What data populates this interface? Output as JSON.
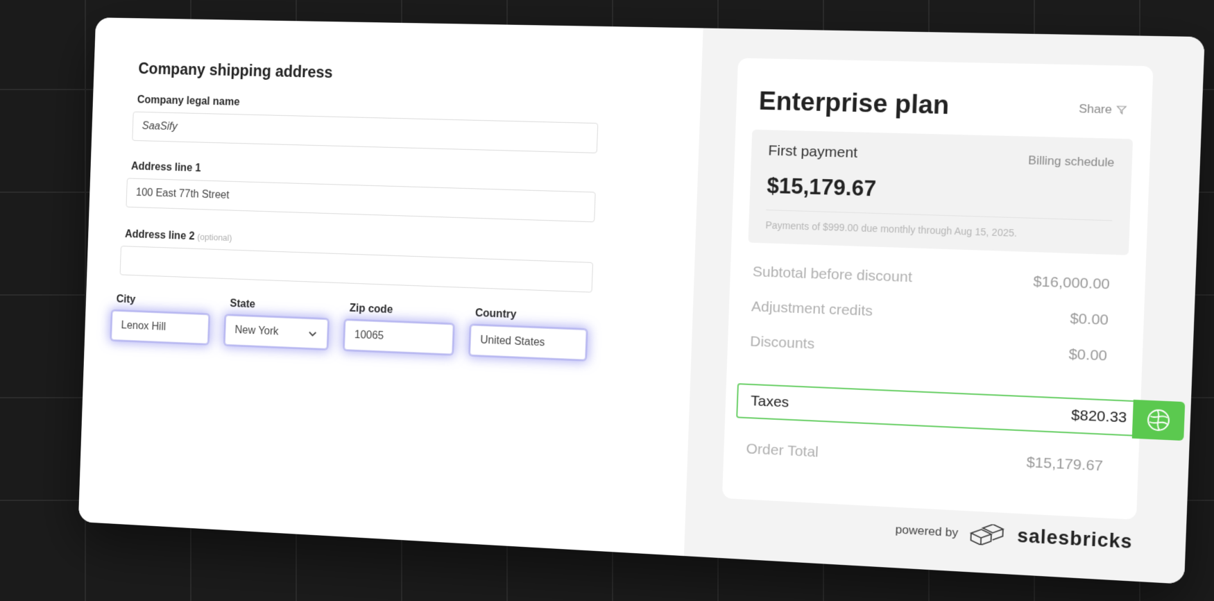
{
  "form": {
    "title": "Company shipping address",
    "company_name": {
      "label": "Company legal name",
      "value": "SaaSify"
    },
    "address1": {
      "label": "Address line 1",
      "value": "100 East 77th Street"
    },
    "address2": {
      "label": "Address line 2",
      "optional": "(optional)",
      "value": ""
    },
    "city": {
      "label": "City",
      "value": "Lenox Hill"
    },
    "state": {
      "label": "State",
      "value": "New York"
    },
    "zip": {
      "label": "Zip code",
      "value": "10065"
    },
    "country": {
      "label": "Country",
      "value": "United States"
    }
  },
  "summary": {
    "plan": "Enterprise plan",
    "share": "Share",
    "first_payment_label": "First payment",
    "billing_schedule": "Billing schedule",
    "first_payment": "$15,179.67",
    "note": "Payments of $999.00 due monthly through Aug 15, 2025.",
    "rows": [
      {
        "label": "Subtotal before discount",
        "value": "$16,000.00"
      },
      {
        "label": "Adjustment credits",
        "value": "$0.00"
      },
      {
        "label": "Discounts",
        "value": "$0.00"
      }
    ],
    "taxes": {
      "label": "Taxes",
      "value": "$820.33"
    },
    "total": {
      "label": "Order Total",
      "value": "$15,179.67"
    },
    "powered_by": "powered by",
    "brand": "salesbricks"
  },
  "colors": {
    "accent_green": "#5bc94f",
    "input_glow": "#7878eb"
  },
  "icons": [
    "share-icon",
    "chevron-down-icon",
    "globe-icon",
    "salesbricks-logo-icon"
  ]
}
